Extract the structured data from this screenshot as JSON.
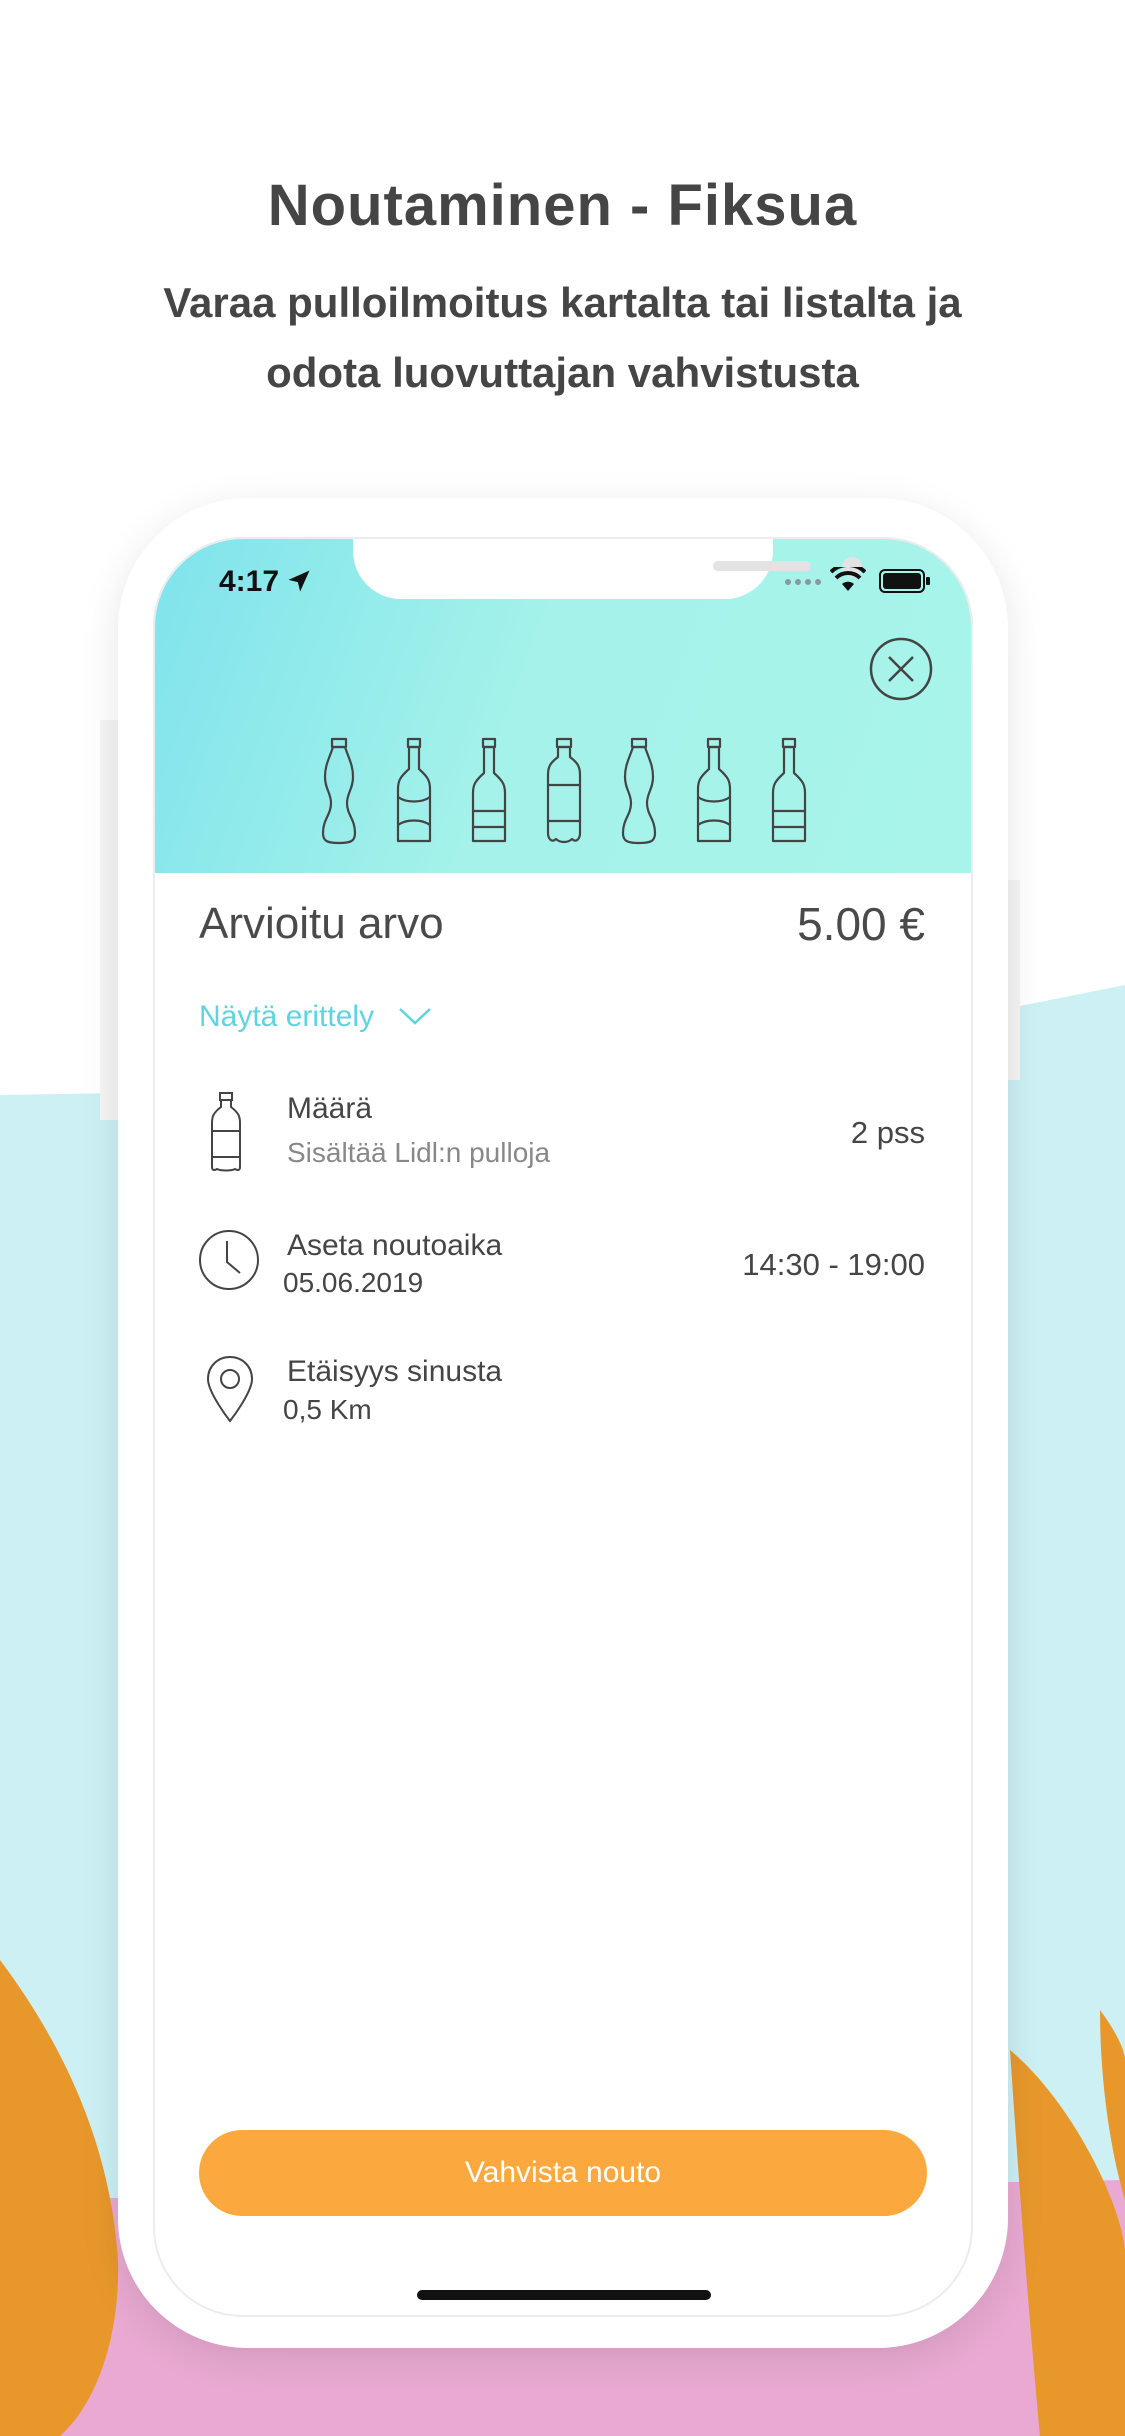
{
  "header": {
    "title": "Noutaminen - Fiksua",
    "subtitle": "Varaa pulloilmoitus kartalta tai listalta ja odota luovuttajan vahvistusta"
  },
  "status_bar": {
    "time": "4:17"
  },
  "estimate": {
    "label": "Arvioitu arvo",
    "value": "5.00 €",
    "breakdown_label": "Näytä erittely"
  },
  "details": [
    {
      "icon": "bottle-icon",
      "title": "Määrä",
      "subtitle": "Sisältää Lidl:n pulloja",
      "value": "2 pss"
    },
    {
      "icon": "clock-icon",
      "title": "Aseta noutoaika",
      "subtitle": "05.06.2019",
      "value": "14:30 - 19:00"
    },
    {
      "icon": "location-pin-icon",
      "title": "Etäisyys sinusta",
      "subtitle": "0,5 Km",
      "value": ""
    }
  ],
  "confirm_button": "Vahvista nouto",
  "colors": {
    "accent_cyan": "#5fd4e0",
    "button_orange": "#fba93e",
    "hero_gradient_start": "#7fe3ec",
    "hero_gradient_end": "#a8f4ea",
    "background_sky": "#ccf0f4",
    "background_ground": "#e9a9d2",
    "background_trees": "#e8982b"
  }
}
